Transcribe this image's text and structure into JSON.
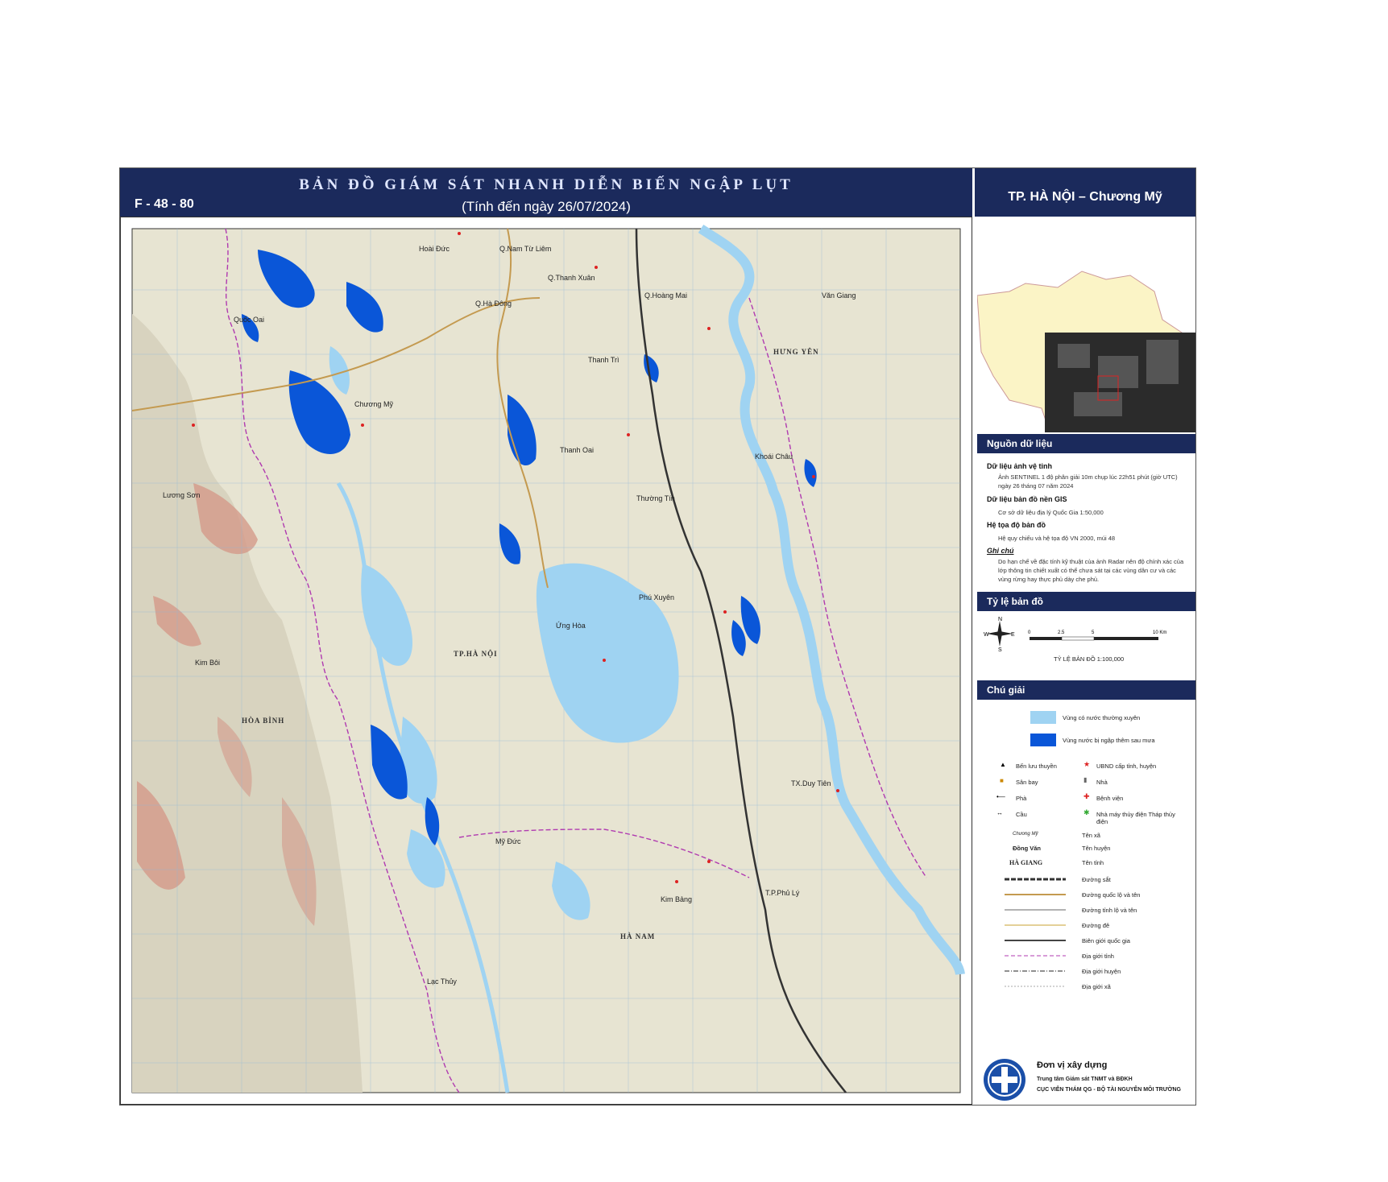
{
  "header": {
    "sheet_id": "F - 48 - 80",
    "title": "BẢN ĐỒ GIÁM SÁT NHANH DIỄN BIẾN NGẬP LỤT",
    "subtitle": "(Tính đến ngày 26/07/2024)",
    "region": "TP. HÀ NỘI – Chương Mỹ"
  },
  "map": {
    "colors": {
      "permanent_water": "#9fd3f2",
      "flood": "#0a56d8",
      "land": "#e9e6d6",
      "relief": "#d79a8c",
      "border": "#b03ab0",
      "road": "#b08840"
    },
    "labels": {
      "hoai_duc": "Hoài Đức",
      "q_nam_tu_liem": "Q.Nam Từ Liêm",
      "q_thanh_xuan": "Q.Thanh Xuân",
      "q_ha_dong": "Q.Hà Đông",
      "q_hoang_mai": "Q.Hoàng Mai",
      "van_giang": "Văn Giang",
      "quoc_oai": "Quốc Oai",
      "thanh_tri": "Thanh Trì",
      "hung_yen": "HƯNG YÊN",
      "chuong_my": "Chương Mỹ",
      "thanh_oai": "Thanh Oai",
      "khoai_chau": "Khoái Châu",
      "luong_son": "Lương Sơn",
      "thuong_tin": "Thường Tín",
      "phu_xuyen": "Phú Xuyên",
      "ung_hoa": "Ứng Hòa",
      "tp_ha_noi": "TP.HÀ NỘI",
      "kim_boi": "Kim Bôi",
      "hoa_binh": "HÒA BÌNH",
      "tx_duy_tien": "TX.Duy Tiên",
      "my_duc": "Mỹ Đức",
      "tp_phu_ly": "T.P.Phủ Lý",
      "kim_bang": "Kim Bảng",
      "ha_nam": "HÀ NAM",
      "lac_thuy": "Lạc Thủy"
    }
  },
  "sidebar": {
    "sources_title": "Nguồn dữ liệu",
    "sat_label": "Dữ liệu ảnh vệ tinh",
    "sat_text": "Ảnh SENTINEL 1 độ phân giải 10m chụp lúc 22h51 phút (giờ UTC) ngày 26 tháng 07 năm 2024",
    "gis_label": "Dữ liệu bản đồ nền GIS",
    "gis_text": "Cơ sở dữ liệu địa lý Quốc Gia 1:50,000",
    "crs_label": "Hệ tọa độ bản đồ",
    "crs_text": "Hệ quy chiếu và hệ tọa độ VN 2000, múi 48",
    "note_label": "Ghi chú",
    "note_text": "Do hạn chế về đặc tính kỹ thuật của ảnh Radar nên độ chính xác của lớp thông tin chiết xuất có thể chưa sát tại các vùng dân cư và các vùng rừng hay thực phủ dày che phủ.",
    "scale_title": "Tỷ lệ bản đồ",
    "scale_ticks": [
      "0",
      "2.5",
      "5",
      "10 Km"
    ],
    "scale_text": "TỶ LỆ BẢN ĐỒ 1:100,000",
    "compass": {
      "n": "N",
      "s": "S",
      "e": "E",
      "w": "W"
    },
    "legend_title": "Chú giải",
    "legend_water": "Vùng có nước thường xuyên",
    "legend_flood": "Vùng nước bị ngập thêm sau mưa",
    "legend_items": [
      {
        "label": "Bến lưu thuyền"
      },
      {
        "label": "UBND cấp tỉnh, huyện"
      },
      {
        "label": "Sân bay"
      },
      {
        "label": "Nhà"
      },
      {
        "label": "Phà"
      },
      {
        "label": "Bệnh viện"
      },
      {
        "label": "Cầu"
      },
      {
        "label": "Nhà máy thủy điện Tháp thủy điện"
      }
    ],
    "legend_names": [
      {
        "sample": "Chương Mỹ",
        "label": "Tên xã"
      },
      {
        "sample": "Đồng Văn",
        "label": "Tên huyện"
      },
      {
        "sample": "HÀ GIANG",
        "label": "Tên tỉnh"
      }
    ],
    "legend_lines": [
      "Đường sắt",
      "Đường quốc lộ và tên",
      "Đường tỉnh lộ và tên",
      "Đường đê",
      "Biên giới quốc gia",
      "Địa giới tỉnh",
      "Địa giới huyện",
      "Địa giới xã"
    ],
    "unit_title": "Đơn vị xây dựng",
    "unit_line1": "Trung tâm Giám sát TNMT và BĐKH",
    "unit_line2": "CỤC VIỄN THÁM QG - BỘ TÀI NGUYÊN MÔI TRƯỜNG"
  }
}
